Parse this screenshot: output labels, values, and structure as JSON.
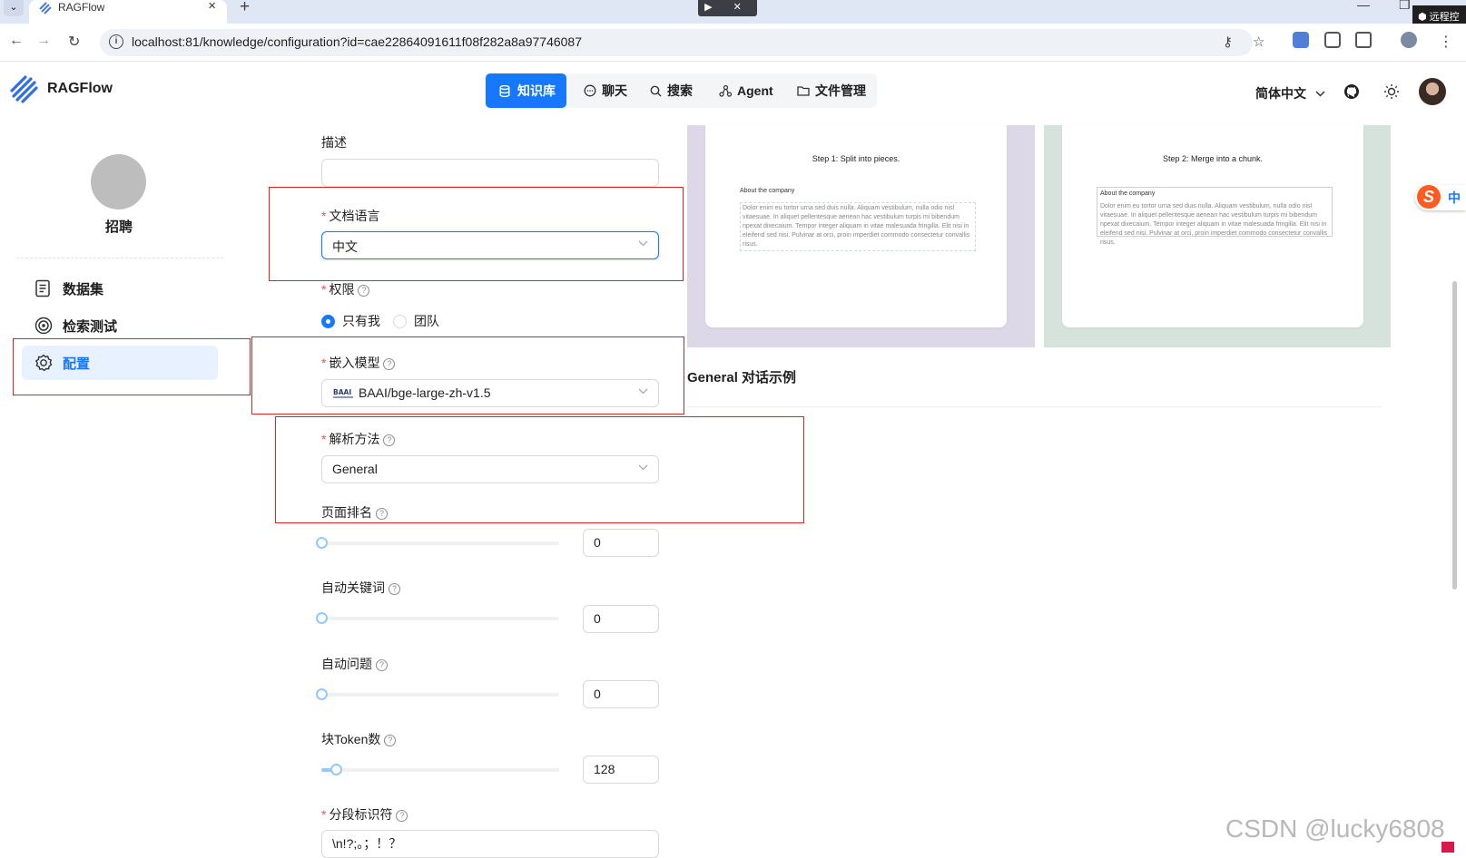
{
  "browser": {
    "tab_title": "RAGFlow",
    "url": "localhost:81/knowledge/configuration?id=cae22864091611f08f282a8a97746087",
    "remote_badge": "远程控",
    "remote_control": "▶ ✕"
  },
  "app": {
    "brand": "RAGFlow"
  },
  "topnav": [
    {
      "label": "知识库",
      "icon": "database-icon",
      "active": true
    },
    {
      "label": "聊天",
      "icon": "chat-icon",
      "active": false
    },
    {
      "label": "搜索",
      "icon": "search-icon",
      "active": false
    },
    {
      "label": "Agent",
      "icon": "agent-icon",
      "active": false
    },
    {
      "label": "文件管理",
      "icon": "folder-icon",
      "active": false
    }
  ],
  "header": {
    "language": "简体中文"
  },
  "sidebar": {
    "kb_name": "招聘",
    "items": [
      {
        "label": "数据集",
        "icon": "dataset-icon",
        "active": false
      },
      {
        "label": "检索测试",
        "icon": "retrieval-test-icon",
        "active": false
      },
      {
        "label": "配置",
        "icon": "settings-icon",
        "active": true
      }
    ]
  },
  "form": {
    "description": {
      "label": "描述",
      "value": ""
    },
    "doc_language": {
      "label": "文档语言",
      "value": "中文",
      "required": true
    },
    "permission": {
      "label": "权限",
      "required": true,
      "options": [
        "只有我",
        "团队"
      ],
      "selected": "只有我"
    },
    "embedding_model": {
      "label": "嵌入模型",
      "value": "BAAI/bge-large-zh-v1.5",
      "required": true
    },
    "chunk_method": {
      "label": "解析方法",
      "value": "General",
      "required": true
    },
    "page_rank": {
      "label": "页面排名",
      "value": "0",
      "fraction": 0
    },
    "auto_keywords": {
      "label": "自动关键词",
      "value": "0",
      "fraction": 0
    },
    "auto_questions": {
      "label": "自动问题",
      "value": "0",
      "fraction": 0
    },
    "chunk_token": {
      "label": "块Token数",
      "value": "128",
      "fraction": 0.06
    },
    "delimiter": {
      "label": "分段标识符",
      "value": "\\n!?;。；！？",
      "required": true
    }
  },
  "preview": {
    "step1_title": "Step 1: Split into pieces.",
    "step2_title": "Step 2: Merge into a chunk.",
    "doc_heading": "About the company",
    "doc_text": "Dolor enim eu tortor urna sed duis nulla. Aliquam vestibulum, nulla odio nisl vitaesuae. In aliquet pellentesque aenean hac vestibulum turpis mi bibendum npexat dixecaium. Tempor integer aliquam in vitae malesuada fringilla. Elit nisi in eleifend sed nisi. Pulvinar at orci, proin imperdiet commodo consectetur convallis risus.",
    "example_title": "General 对话示例"
  },
  "overlays": {
    "ime_label": "中",
    "watermark": "CSDN @lucky6808"
  },
  "colors": {
    "accent": "#1677ff",
    "annotation": "#e02424"
  }
}
